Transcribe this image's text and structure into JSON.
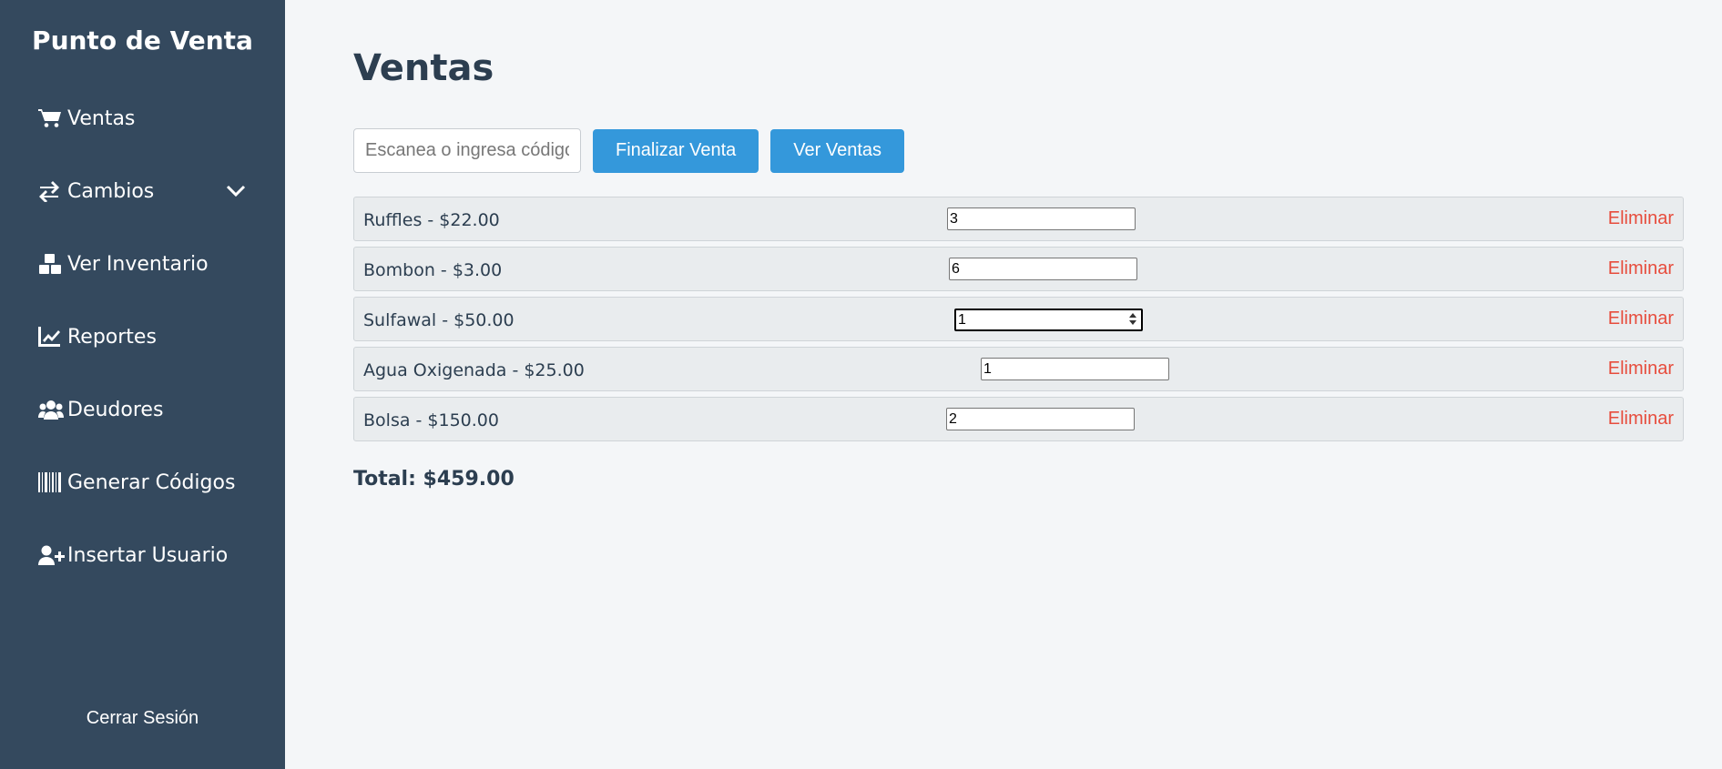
{
  "sidebar": {
    "brand": "Punto de Venta",
    "items": [
      {
        "label": "Ventas",
        "icon": "cart-icon"
      },
      {
        "label": "Cambios",
        "icon": "exchange-icon"
      },
      {
        "label": "Ver Inventario",
        "icon": "boxes-icon"
      },
      {
        "label": "Reportes",
        "icon": "chart-line-icon"
      },
      {
        "label": "Deudores",
        "icon": "users-icon"
      },
      {
        "label": "Generar Códigos",
        "icon": "barcode-icon"
      },
      {
        "label": "Insertar Usuario",
        "icon": "user-plus-icon"
      }
    ],
    "logout_label": "Cerrar Sesión"
  },
  "main": {
    "title": "Ventas",
    "search": {
      "placeholder": "Escanea o ingresa código",
      "value": ""
    },
    "finalize_label": "Finalizar Venta",
    "view_sales_label": "Ver Ventas",
    "items": [
      {
        "label": "Ruffles - $22.00",
        "qty": "3",
        "remove": "Eliminar"
      },
      {
        "label": "Bombon - $3.00",
        "qty": "6",
        "remove": "Eliminar"
      },
      {
        "label": "Sulfawal - $50.00",
        "qty": "1",
        "remove": "Eliminar"
      },
      {
        "label": "Agua Oxigenada - $25.00",
        "qty": "1",
        "remove": "Eliminar"
      },
      {
        "label": "Bolsa - $150.00",
        "qty": "2",
        "remove": "Eliminar"
      }
    ],
    "total": "Total: $459.00"
  },
  "colors": {
    "sidebar": "#34495e",
    "accent": "#3498db",
    "danger": "#e74c3c",
    "background": "#f4f6f8"
  }
}
